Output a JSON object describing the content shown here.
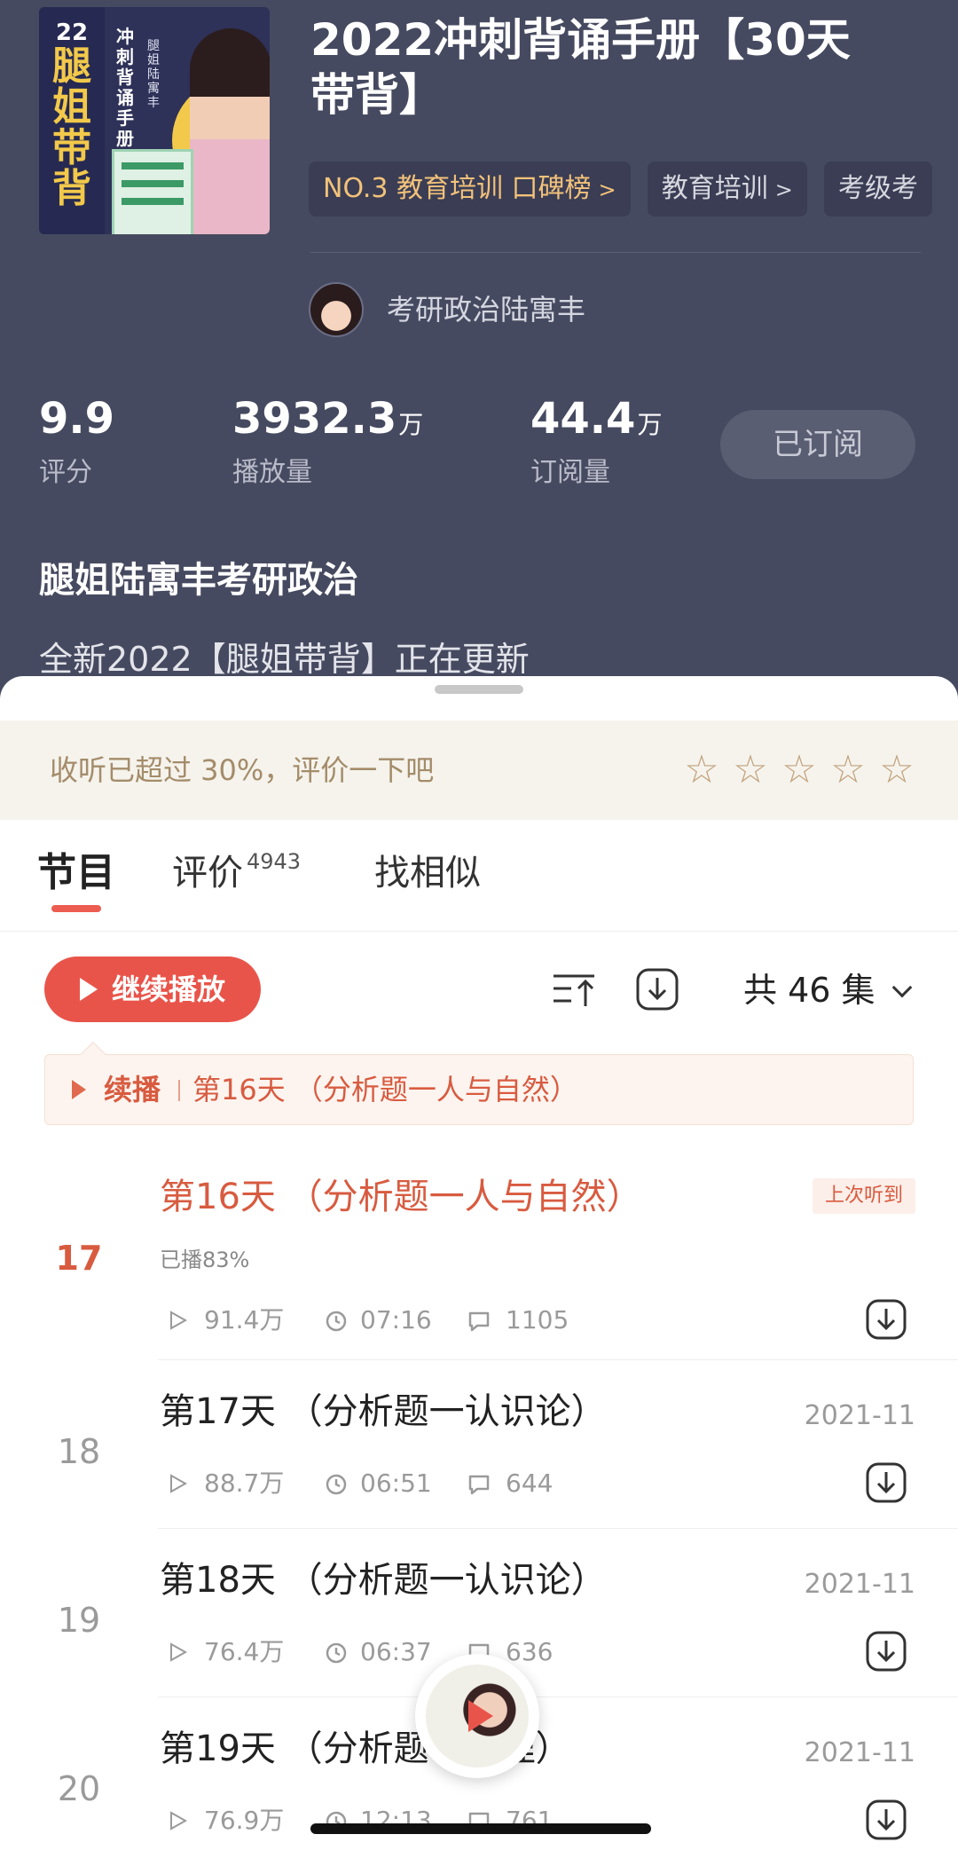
{
  "header": {
    "cover": {
      "number": "22",
      "big_title": [
        "腿",
        "姐",
        "带",
        "背"
      ],
      "side_title": "冲刺背诵手册",
      "side_author": "腿姐陆寓丰"
    },
    "title_line1": "2022冲刺背诵手册【30天",
    "title_line2": "带背】",
    "chips": [
      {
        "label": "NO.3 教育培训 口碑榜",
        "arrow": ">"
      },
      {
        "label": "教育培训",
        "arrow": ">"
      },
      {
        "label": "考级考",
        "arrow": ""
      }
    ],
    "author": "考研政治陆寓丰",
    "stats": [
      {
        "value": "9.9",
        "unit": "",
        "label": "评分"
      },
      {
        "value": "3932.3",
        "unit": "万",
        "label": "播放量"
      },
      {
        "value": "44.4",
        "unit": "万",
        "label": "订阅量"
      }
    ],
    "subscribe_label": "已订阅",
    "channel_name": "腿姐陆寓丰考研政治",
    "description": "全新2022【腿姐带背】正在更新"
  },
  "rating_prompt": {
    "text": "收听已超过 30%，评价一下吧",
    "stars": [
      "☆",
      "☆",
      "☆",
      "☆",
      "☆"
    ]
  },
  "tabs": [
    {
      "label": "节目",
      "badge": ""
    },
    {
      "label": "评价",
      "badge": "4943"
    },
    {
      "label": "找相似",
      "badge": ""
    }
  ],
  "toolbar": {
    "play_label": "继续播放",
    "count_label": "共 46 集"
  },
  "resume_bar": {
    "prefix": "续播",
    "title": "第16天 （分析题一人与自然）"
  },
  "episodes": [
    {
      "no": "17",
      "title": "第16天 （分析题一人与自然）",
      "badge": "上次听到",
      "progress": "已播83%",
      "plays": "91.4万",
      "duration": "07:16",
      "comments": "1105",
      "date": ""
    },
    {
      "no": "18",
      "title": "第17天 （分析题一认识论）",
      "badge": "",
      "progress": "",
      "plays": "88.7万",
      "duration": "06:51",
      "comments": "644",
      "date": "2021-11"
    },
    {
      "no": "19",
      "title": "第18天 （分析题一认识论）",
      "badge": "",
      "progress": "",
      "plays": "76.4万",
      "duration": "06:37",
      "comments": "636",
      "date": "2021-11"
    },
    {
      "no": "20",
      "title": "第19天 （分析题一真理）",
      "badge": "",
      "progress": "",
      "plays": "76.9万",
      "duration": "12:13",
      "comments": "761",
      "date": "2021-11"
    }
  ],
  "colors": {
    "header_bg": "#464a60",
    "accent_red": "#e9544a",
    "gold": "#f3c27a"
  }
}
